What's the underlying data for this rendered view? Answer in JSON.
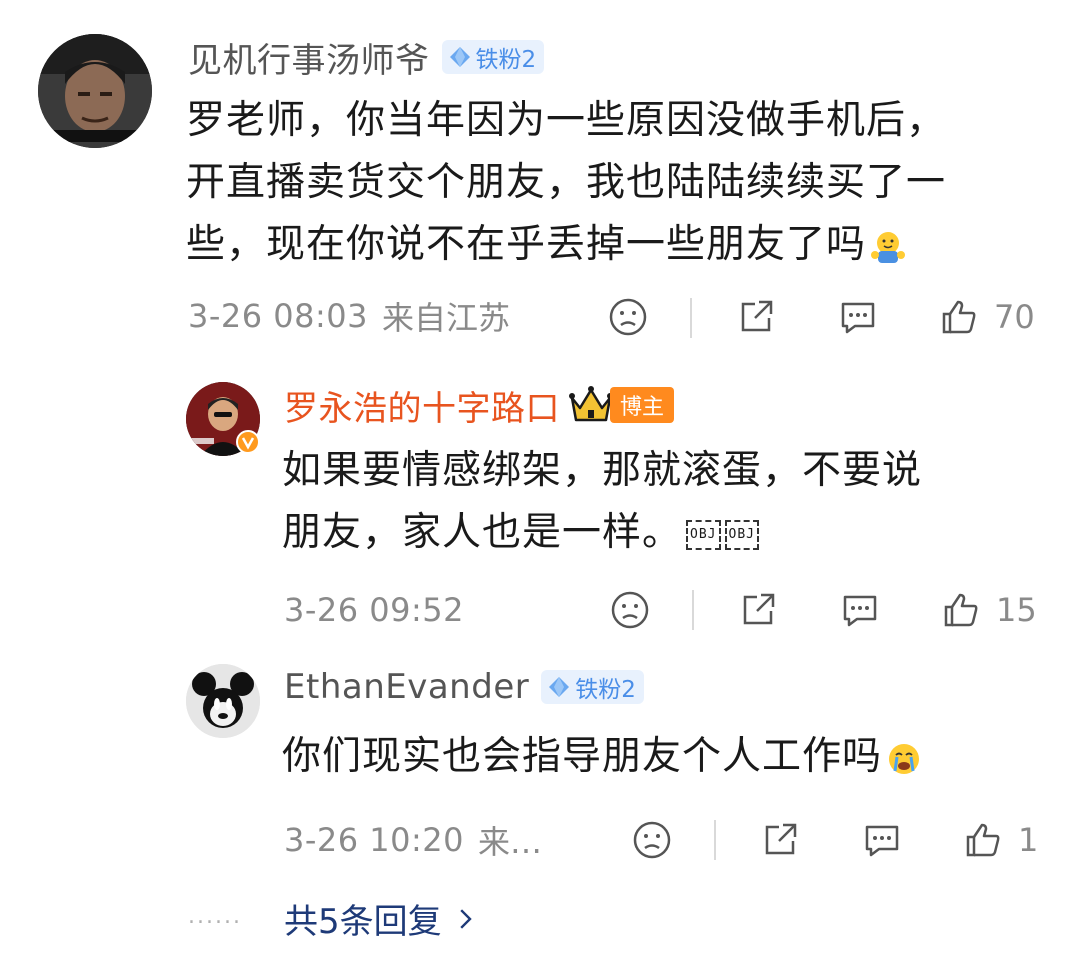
{
  "comments": [
    {
      "username": "见机行事汤师爷",
      "badge": "铁粉2",
      "text_lines": [
        "罗老师，你当年因为一些原因没做手机后，",
        "开直播卖货交个朋友，我也陆陆续续买了一",
        "些，现在你说不在乎丢掉一些朋友了吗"
      ],
      "emoji": "hug-emoji",
      "time": "3-26 08:03",
      "origin": "来自江苏",
      "likes": "70"
    },
    {
      "username": "罗永浩的十字路口",
      "author_badge": "博主",
      "text_lines": [
        "如果要情感绑架，那就滚蛋，不要说",
        "朋友，家人也是一样。"
      ],
      "obj_placeholders": [
        "OBJ",
        "OBJ"
      ],
      "time": "3-26 09:52",
      "likes": "15"
    },
    {
      "username": "EthanEvander",
      "badge": "铁粉2",
      "text_lines": [
        "你们现实也会指导朋友个人工作吗"
      ],
      "emoji": "crying-emoji",
      "time": "3-26 10:20",
      "origin": "来…",
      "likes": "1"
    }
  ],
  "more_replies": {
    "dots": "......",
    "label": "共5条回复",
    "icon": "chevron-right-icon"
  },
  "colors": {
    "vip_name": "#e8541f",
    "badge_bg": "#e8f1fd",
    "badge_fg": "#4a8ee8",
    "author_badge": "#ff8a1e",
    "meta": "#8a8a8a",
    "link": "#1e3a78"
  }
}
